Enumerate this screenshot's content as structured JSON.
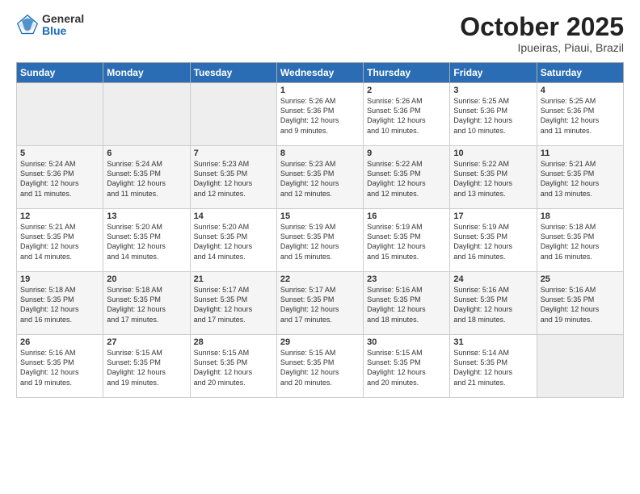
{
  "header": {
    "logo_general": "General",
    "logo_blue": "Blue",
    "month": "October 2025",
    "location": "Ipueiras, Piaui, Brazil"
  },
  "weekdays": [
    "Sunday",
    "Monday",
    "Tuesday",
    "Wednesday",
    "Thursday",
    "Friday",
    "Saturday"
  ],
  "weeks": [
    [
      {
        "day": "",
        "info": ""
      },
      {
        "day": "",
        "info": ""
      },
      {
        "day": "",
        "info": ""
      },
      {
        "day": "1",
        "info": "Sunrise: 5:26 AM\nSunset: 5:36 PM\nDaylight: 12 hours\nand 9 minutes."
      },
      {
        "day": "2",
        "info": "Sunrise: 5:26 AM\nSunset: 5:36 PM\nDaylight: 12 hours\nand 10 minutes."
      },
      {
        "day": "3",
        "info": "Sunrise: 5:25 AM\nSunset: 5:36 PM\nDaylight: 12 hours\nand 10 minutes."
      },
      {
        "day": "4",
        "info": "Sunrise: 5:25 AM\nSunset: 5:36 PM\nDaylight: 12 hours\nand 11 minutes."
      }
    ],
    [
      {
        "day": "5",
        "info": "Sunrise: 5:24 AM\nSunset: 5:36 PM\nDaylight: 12 hours\nand 11 minutes."
      },
      {
        "day": "6",
        "info": "Sunrise: 5:24 AM\nSunset: 5:35 PM\nDaylight: 12 hours\nand 11 minutes."
      },
      {
        "day": "7",
        "info": "Sunrise: 5:23 AM\nSunset: 5:35 PM\nDaylight: 12 hours\nand 12 minutes."
      },
      {
        "day": "8",
        "info": "Sunrise: 5:23 AM\nSunset: 5:35 PM\nDaylight: 12 hours\nand 12 minutes."
      },
      {
        "day": "9",
        "info": "Sunrise: 5:22 AM\nSunset: 5:35 PM\nDaylight: 12 hours\nand 12 minutes."
      },
      {
        "day": "10",
        "info": "Sunrise: 5:22 AM\nSunset: 5:35 PM\nDaylight: 12 hours\nand 13 minutes."
      },
      {
        "day": "11",
        "info": "Sunrise: 5:21 AM\nSunset: 5:35 PM\nDaylight: 12 hours\nand 13 minutes."
      }
    ],
    [
      {
        "day": "12",
        "info": "Sunrise: 5:21 AM\nSunset: 5:35 PM\nDaylight: 12 hours\nand 14 minutes."
      },
      {
        "day": "13",
        "info": "Sunrise: 5:20 AM\nSunset: 5:35 PM\nDaylight: 12 hours\nand 14 minutes."
      },
      {
        "day": "14",
        "info": "Sunrise: 5:20 AM\nSunset: 5:35 PM\nDaylight: 12 hours\nand 14 minutes."
      },
      {
        "day": "15",
        "info": "Sunrise: 5:19 AM\nSunset: 5:35 PM\nDaylight: 12 hours\nand 15 minutes."
      },
      {
        "day": "16",
        "info": "Sunrise: 5:19 AM\nSunset: 5:35 PM\nDaylight: 12 hours\nand 15 minutes."
      },
      {
        "day": "17",
        "info": "Sunrise: 5:19 AM\nSunset: 5:35 PM\nDaylight: 12 hours\nand 16 minutes."
      },
      {
        "day": "18",
        "info": "Sunrise: 5:18 AM\nSunset: 5:35 PM\nDaylight: 12 hours\nand 16 minutes."
      }
    ],
    [
      {
        "day": "19",
        "info": "Sunrise: 5:18 AM\nSunset: 5:35 PM\nDaylight: 12 hours\nand 16 minutes."
      },
      {
        "day": "20",
        "info": "Sunrise: 5:18 AM\nSunset: 5:35 PM\nDaylight: 12 hours\nand 17 minutes."
      },
      {
        "day": "21",
        "info": "Sunrise: 5:17 AM\nSunset: 5:35 PM\nDaylight: 12 hours\nand 17 minutes."
      },
      {
        "day": "22",
        "info": "Sunrise: 5:17 AM\nSunset: 5:35 PM\nDaylight: 12 hours\nand 17 minutes."
      },
      {
        "day": "23",
        "info": "Sunrise: 5:16 AM\nSunset: 5:35 PM\nDaylight: 12 hours\nand 18 minutes."
      },
      {
        "day": "24",
        "info": "Sunrise: 5:16 AM\nSunset: 5:35 PM\nDaylight: 12 hours\nand 18 minutes."
      },
      {
        "day": "25",
        "info": "Sunrise: 5:16 AM\nSunset: 5:35 PM\nDaylight: 12 hours\nand 19 minutes."
      }
    ],
    [
      {
        "day": "26",
        "info": "Sunrise: 5:16 AM\nSunset: 5:35 PM\nDaylight: 12 hours\nand 19 minutes."
      },
      {
        "day": "27",
        "info": "Sunrise: 5:15 AM\nSunset: 5:35 PM\nDaylight: 12 hours\nand 19 minutes."
      },
      {
        "day": "28",
        "info": "Sunrise: 5:15 AM\nSunset: 5:35 PM\nDaylight: 12 hours\nand 20 minutes."
      },
      {
        "day": "29",
        "info": "Sunrise: 5:15 AM\nSunset: 5:35 PM\nDaylight: 12 hours\nand 20 minutes."
      },
      {
        "day": "30",
        "info": "Sunrise: 5:15 AM\nSunset: 5:35 PM\nDaylight: 12 hours\nand 20 minutes."
      },
      {
        "day": "31",
        "info": "Sunrise: 5:14 AM\nSunset: 5:35 PM\nDaylight: 12 hours\nand 21 minutes."
      },
      {
        "day": "",
        "info": ""
      }
    ]
  ]
}
